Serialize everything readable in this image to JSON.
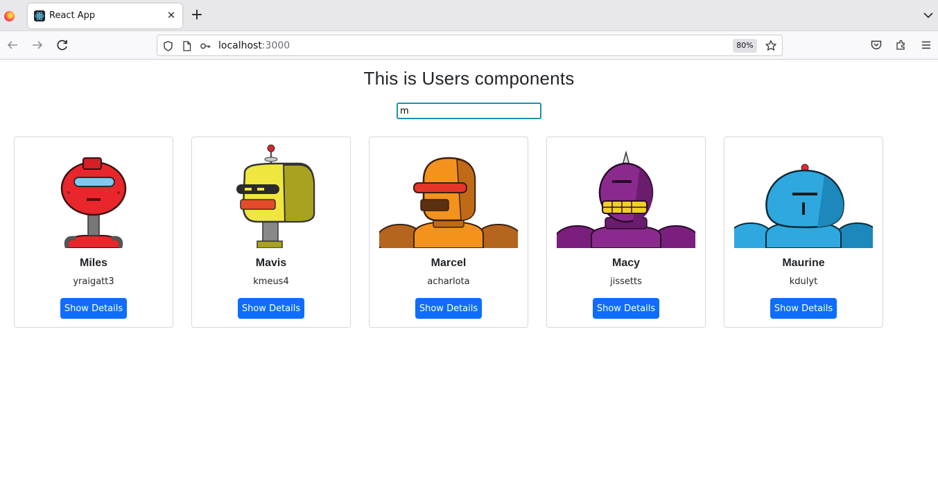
{
  "browser": {
    "tab_title": "React App",
    "url_host": "localhost",
    "url_port": ":3000",
    "zoom": "80%",
    "icons": [
      "firefox-icon",
      "react-icon",
      "close-icon",
      "plus-icon",
      "chevron-down-icon",
      "back-icon",
      "forward-icon",
      "reload-icon",
      "shield-icon",
      "page-icon",
      "key-icon",
      "star-icon",
      "pocket-icon",
      "extensions-icon",
      "menu-icon"
    ]
  },
  "page": {
    "title": "This is Users components",
    "search_value": "m"
  },
  "users": [
    {
      "name": "Miles",
      "username": "yraigatt3",
      "button": "Show Details",
      "color": "#e8262b"
    },
    {
      "name": "Mavis",
      "username": "kmeus4",
      "button": "Show Details",
      "color": "#f0e640"
    },
    {
      "name": "Marcel",
      "username": "acharlota",
      "button": "Show Details",
      "color": "#f3921d"
    },
    {
      "name": "Macy",
      "username": "jissetts",
      "button": "Show Details",
      "color": "#8b2a8e"
    },
    {
      "name": "Maurine",
      "username": "kdulyt",
      "button": "Show Details",
      "color": "#2ea8df"
    }
  ],
  "colors": {
    "accent": "#0d6efd",
    "focus_border": "#1f8fa8"
  }
}
